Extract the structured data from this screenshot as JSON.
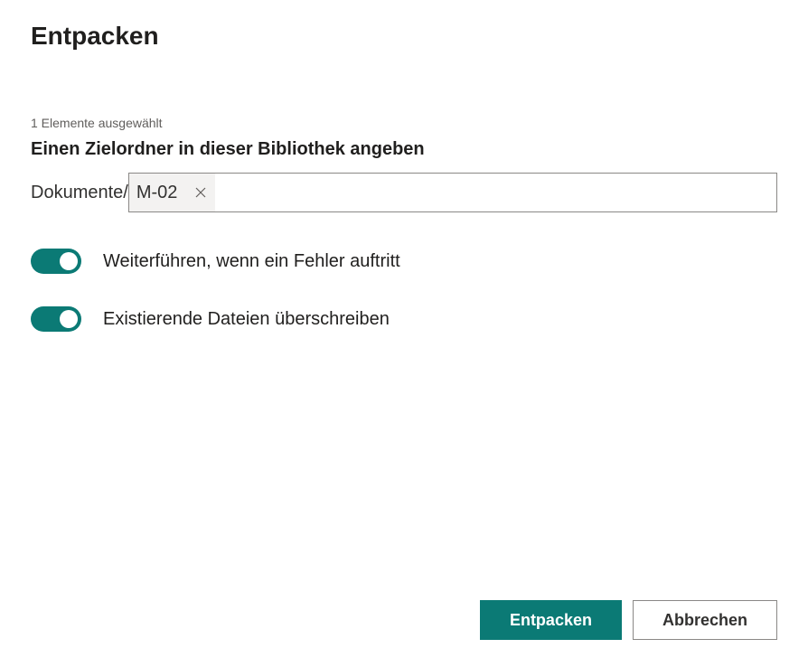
{
  "dialog": {
    "title": "Entpacken",
    "selection_count": "1 Elemente ausgewählt",
    "folder_label": "Einen Zielordner in dieser Bibliothek angeben",
    "path_prefix": "Dokumente/",
    "path_chip": "M-02",
    "path_input_value": ""
  },
  "toggles": {
    "continue_on_error": {
      "label": "Weiterführen, wenn ein Fehler auftritt",
      "on": true
    },
    "overwrite_existing": {
      "label": "Existierende Dateien überschreiben",
      "on": true
    }
  },
  "buttons": {
    "primary": "Entpacken",
    "cancel": "Abbrechen"
  },
  "colors": {
    "accent": "#0b7a75"
  }
}
